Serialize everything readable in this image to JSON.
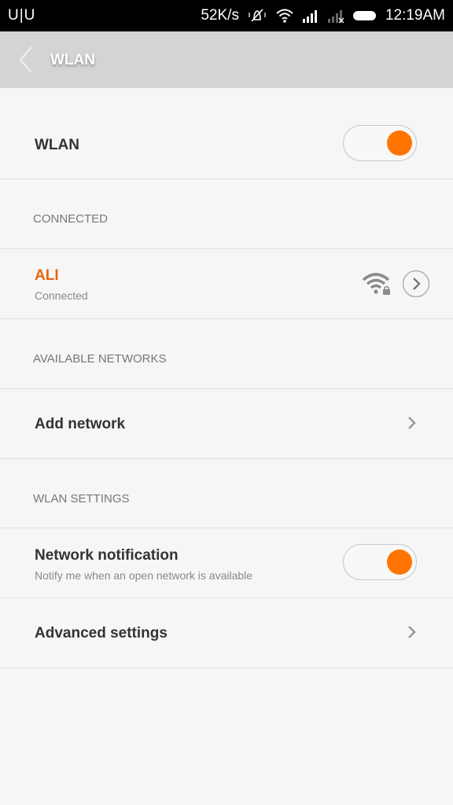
{
  "status_bar": {
    "carrier": "U|U",
    "speed": "52K/s",
    "icons": [
      "vibrate-mute-icon",
      "wifi-icon",
      "signal-icon",
      "signal-no-service-icon",
      "battery-icon"
    ],
    "time": "12:19AM"
  },
  "header": {
    "title": "WLAN",
    "back_icon": "back-arrow-icon"
  },
  "wlan_toggle": {
    "label": "WLAN",
    "on": true
  },
  "connected_section": {
    "title": "CONNECTED"
  },
  "connected_network": {
    "ssid": "ALI",
    "status": "Connected",
    "accent_color": "#e8640e"
  },
  "available_section": {
    "title": "AVAILABLE NETWORKS"
  },
  "add_network": {
    "label": "Add network"
  },
  "settings_section": {
    "title": "WLAN SETTINGS"
  },
  "network_notification": {
    "label": "Network notification",
    "description": "Notify me when an open network is available",
    "on": true
  },
  "advanced_settings": {
    "label": "Advanced settings"
  },
  "colors": {
    "accent": "#ff7400",
    "header_bg": "#d4d4d4"
  }
}
